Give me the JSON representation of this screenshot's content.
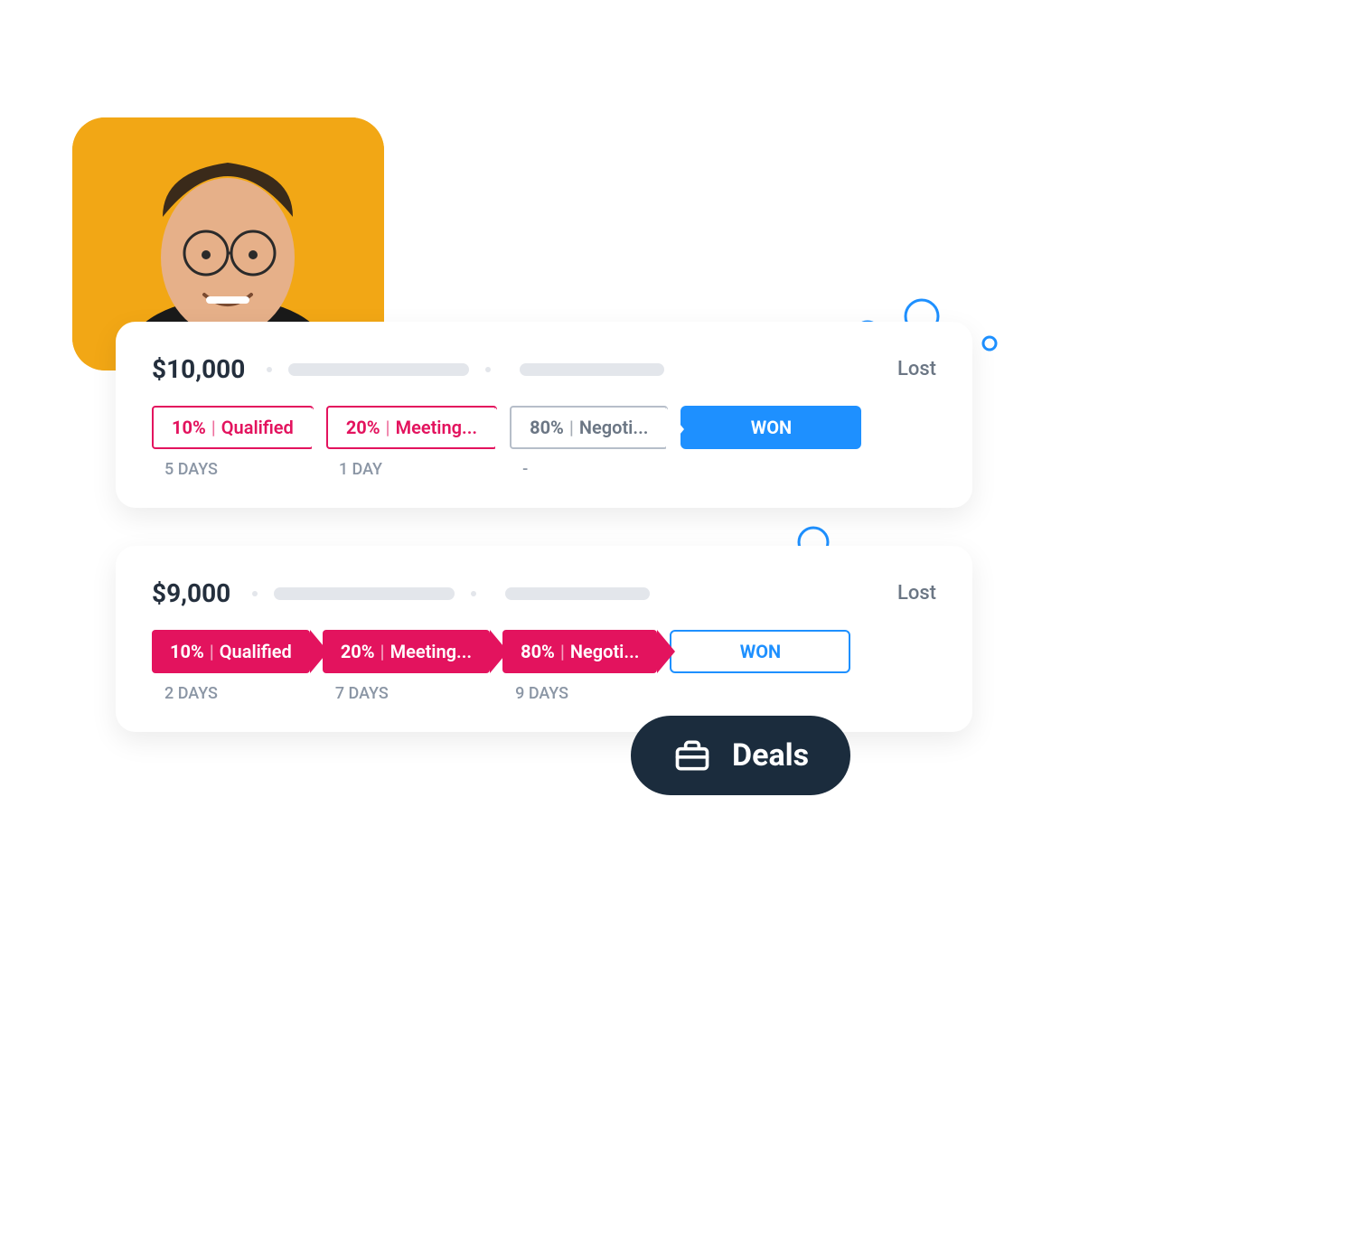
{
  "colors": {
    "accent_red": "#e3135e",
    "accent_blue": "#1e90ff",
    "avatar_bg": "#f2a715",
    "pill_bg": "#1b2c3d"
  },
  "deals_pill": {
    "label": "Deals"
  },
  "deals": [
    {
      "amount": "$10,000",
      "status_right": "Lost",
      "stages": [
        {
          "pct": "10%",
          "name": "Qualified",
          "days": "5 DAYS",
          "style": "outline-red"
        },
        {
          "pct": "20%",
          "name": "Meeting...",
          "days": "1 DAY",
          "style": "outline-red"
        },
        {
          "pct": "80%",
          "name": "Negoti...",
          "days": "-",
          "style": "outline-gray"
        }
      ],
      "won": {
        "label": "WON",
        "style": "solid-blue"
      }
    },
    {
      "amount": "$9,000",
      "status_right": "Lost",
      "stages": [
        {
          "pct": "10%",
          "name": "Qualified",
          "days": "2 DAYS",
          "style": "solid-red"
        },
        {
          "pct": "20%",
          "name": "Meeting...",
          "days": "7 DAYS",
          "style": "solid-red"
        },
        {
          "pct": "80%",
          "name": "Negoti...",
          "days": "9 DAYS",
          "style": "solid-red"
        }
      ],
      "won": {
        "label": "WON",
        "style": "outline-blue"
      }
    }
  ]
}
